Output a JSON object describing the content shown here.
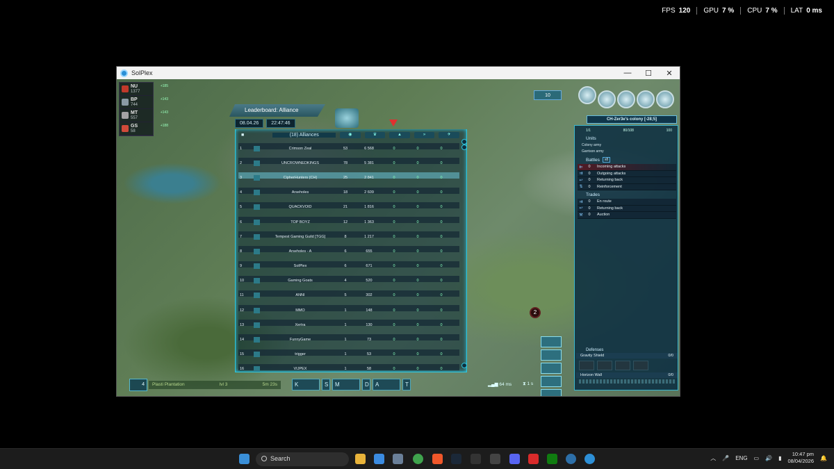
{
  "overlay": {
    "fps_label": "FPS",
    "fps_value": "120",
    "gpu_label": "GPU",
    "gpu_value": "7 %",
    "cpu_label": "CPU",
    "cpu_value": "7 %",
    "lat_label": "LAT",
    "lat_value": "0 ms"
  },
  "window": {
    "title": "SolPlex",
    "minimize": "—",
    "maximize": "☐",
    "close": "✕"
  },
  "resources": [
    {
      "code": "NU",
      "value": "1377",
      "rate": "+185"
    },
    {
      "code": "BP",
      "value": "744",
      "rate": "+143"
    },
    {
      "code": "MT",
      "value": "557",
      "rate": "+143"
    },
    {
      "code": "GS",
      "value": "58",
      "rate": "+188"
    }
  ],
  "leaderboard": {
    "title": "Leaderboard: Alliance",
    "date": "08.04.26",
    "time": "22:47:46",
    "col_header": "(18)   Alliances",
    "rows": [
      {
        "rank": "1",
        "name": "Crimson Zeal",
        "members": "53",
        "points": "6 568",
        "a": "0",
        "b": "0",
        "c": "0"
      },
      {
        "rank": "2",
        "name": "UNCROWNEDKINGS",
        "members": "78",
        "points": "5 381",
        "a": "0",
        "b": "0",
        "c": "0"
      },
      {
        "rank": "3",
        "name": "CipherHunters (CH)",
        "members": "25",
        "points": "2 841",
        "a": "0",
        "b": "0",
        "c": "0"
      },
      {
        "rank": "4",
        "name": "Arseholes",
        "members": "18",
        "points": "2 609",
        "a": "0",
        "b": "0",
        "c": "0"
      },
      {
        "rank": "5",
        "name": "QUACKVOID",
        "members": "21",
        "points": "1 816",
        "a": "0",
        "b": "0",
        "c": "0"
      },
      {
        "rank": "6",
        "name": "TOP BOYZ",
        "members": "12",
        "points": "1 363",
        "a": "0",
        "b": "0",
        "c": "0"
      },
      {
        "rank": "7",
        "name": "Tempest Gaming Guild [TGG]",
        "members": "8",
        "points": "1 217",
        "a": "0",
        "b": "0",
        "c": "0"
      },
      {
        "rank": "8",
        "name": "Arseholes - A",
        "members": "6",
        "points": "655",
        "a": "0",
        "b": "0",
        "c": "0"
      },
      {
        "rank": "9",
        "name": "SolPlex",
        "members": "6",
        "points": "671",
        "a": "0",
        "b": "0",
        "c": "0"
      },
      {
        "rank": "10",
        "name": "Gaming Goats",
        "members": "4",
        "points": "520",
        "a": "0",
        "b": "0",
        "c": "0"
      },
      {
        "rank": "11",
        "name": "ANNI",
        "members": "5",
        "points": "302",
        "a": "0",
        "b": "0",
        "c": "0"
      },
      {
        "rank": "12",
        "name": "MMO",
        "members": "1",
        "points": "148",
        "a": "0",
        "b": "0",
        "c": "0"
      },
      {
        "rank": "13",
        "name": "Xertra",
        "members": "1",
        "points": "130",
        "a": "0",
        "b": "0",
        "c": "0"
      },
      {
        "rank": "14",
        "name": "FunnyGame",
        "members": "1",
        "points": "73",
        "a": "0",
        "b": "0",
        "c": "0"
      },
      {
        "rank": "15",
        "name": "trigger",
        "members": "1",
        "points": "53",
        "a": "0",
        "b": "0",
        "c": "0"
      },
      {
        "rank": "16",
        "name": "VIJPEX",
        "members": "1",
        "points": "58",
        "a": "0",
        "b": "0",
        "c": "0"
      }
    ]
  },
  "right_panel": {
    "count": "10",
    "colony": "CH-Zer3e's colony [-28;5]",
    "stats": [
      "1/1",
      "80/108",
      "100"
    ],
    "units_title": "Units",
    "units": [
      "Colony army",
      "Garrison army"
    ],
    "battles_title": "Battles",
    "battles_tag": "x8",
    "battles": [
      {
        "n": "0",
        "label": "Incoming attacks"
      },
      {
        "n": "0",
        "label": "Outgoing attacks"
      },
      {
        "n": "0",
        "label": "Returning back"
      },
      {
        "n": "0",
        "label": "Reinforcement"
      }
    ],
    "trades_title": "Trades",
    "trades": [
      {
        "n": "0",
        "label": "En route"
      },
      {
        "n": "0",
        "label": "Returning back"
      },
      {
        "n": "0",
        "label": "Auction"
      }
    ],
    "defenses_title": "Defenses",
    "defenses": [
      {
        "name": "Gravity Shield",
        "value": "0/0"
      },
      {
        "name": "Horizon Wall",
        "value": "0/0"
      }
    ]
  },
  "bottom": {
    "res_count": "4",
    "plant_name": "Plasti Plantation",
    "plant_level": "lvl 3",
    "plant_time": "5m 23s",
    "tabs": [
      "K",
      "S",
      "M",
      "D",
      "A",
      "T"
    ],
    "ping": "64 ms",
    "timer": "1 s",
    "marker": "2"
  },
  "taskbar": {
    "search": "Search",
    "lang": "ENG",
    "time": "10:47 pm",
    "date": "08/04/2026"
  }
}
